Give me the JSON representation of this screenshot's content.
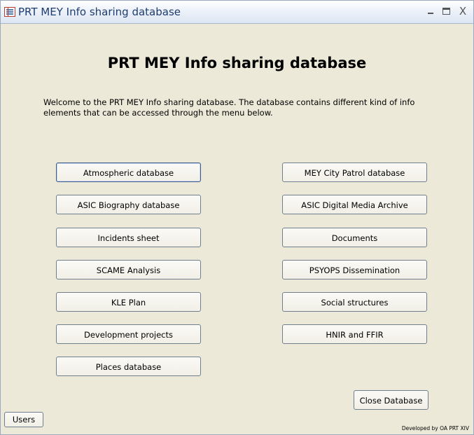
{
  "window": {
    "title": "PRT MEY Info sharing database",
    "controls": {
      "minimize": "minimize-icon",
      "maximize": "maximize-icon",
      "close": "X"
    }
  },
  "main": {
    "heading": "PRT MEY Info sharing database",
    "welcome": "Welcome to the PRT MEY Info sharing database. The database contains different kind of info elements that can be accessed through the menu below."
  },
  "menu": {
    "left": [
      "Atmospheric database",
      "ASIC Biography database",
      "Incidents sheet",
      "SCAME Analysis",
      "KLE Plan",
      "Development projects",
      "Places database"
    ],
    "right": [
      "MEY City Patrol database",
      "ASIC Digital Media Archive",
      "Documents",
      "PSYOPS Dissemination",
      "Social structures",
      "HNIR and FFIR"
    ]
  },
  "actions": {
    "close_database": "Close Database",
    "users": "Users"
  },
  "footer": "Developed by OA PRT XIV"
}
